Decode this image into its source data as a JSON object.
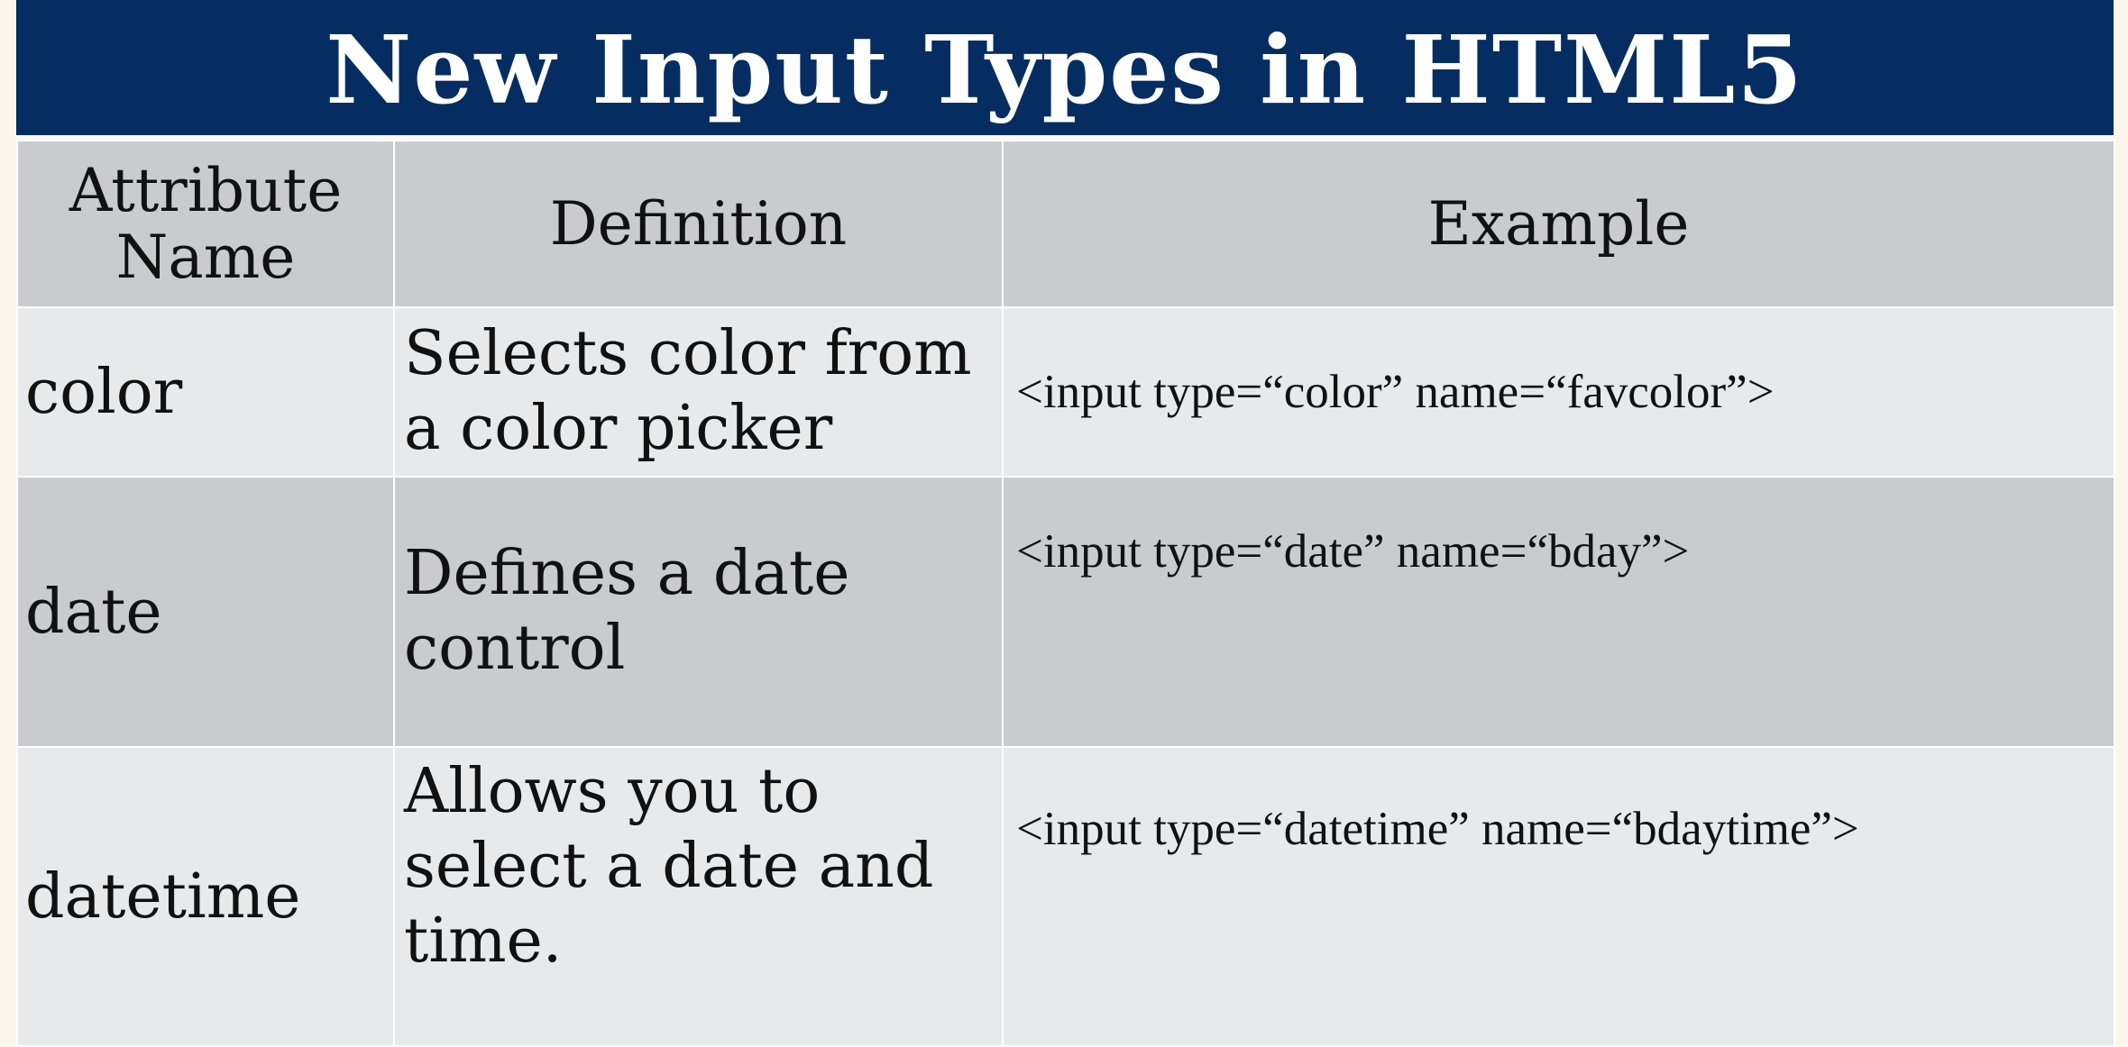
{
  "title": "New Input Types in HTML5",
  "table": {
    "headers": [
      "Attribute\nName",
      "Definition",
      "Example"
    ],
    "rows": [
      {
        "name": "color",
        "definition": "Selects color from a color picker",
        "example": "<input type=“color” name=“favcolor”>"
      },
      {
        "name": "date",
        "definition": "Defines a date control",
        "example": "<input type=“date” name=“bday”>"
      },
      {
        "name": "datetime",
        "definition": "Allows you to select a date and time.",
        "example": "<input type=“datetime” name=“bdaytime”>"
      }
    ]
  },
  "colors": {
    "title_bar": "#052d62",
    "header_row": "#cacbcf",
    "light_row": "#e8e9eb"
  }
}
